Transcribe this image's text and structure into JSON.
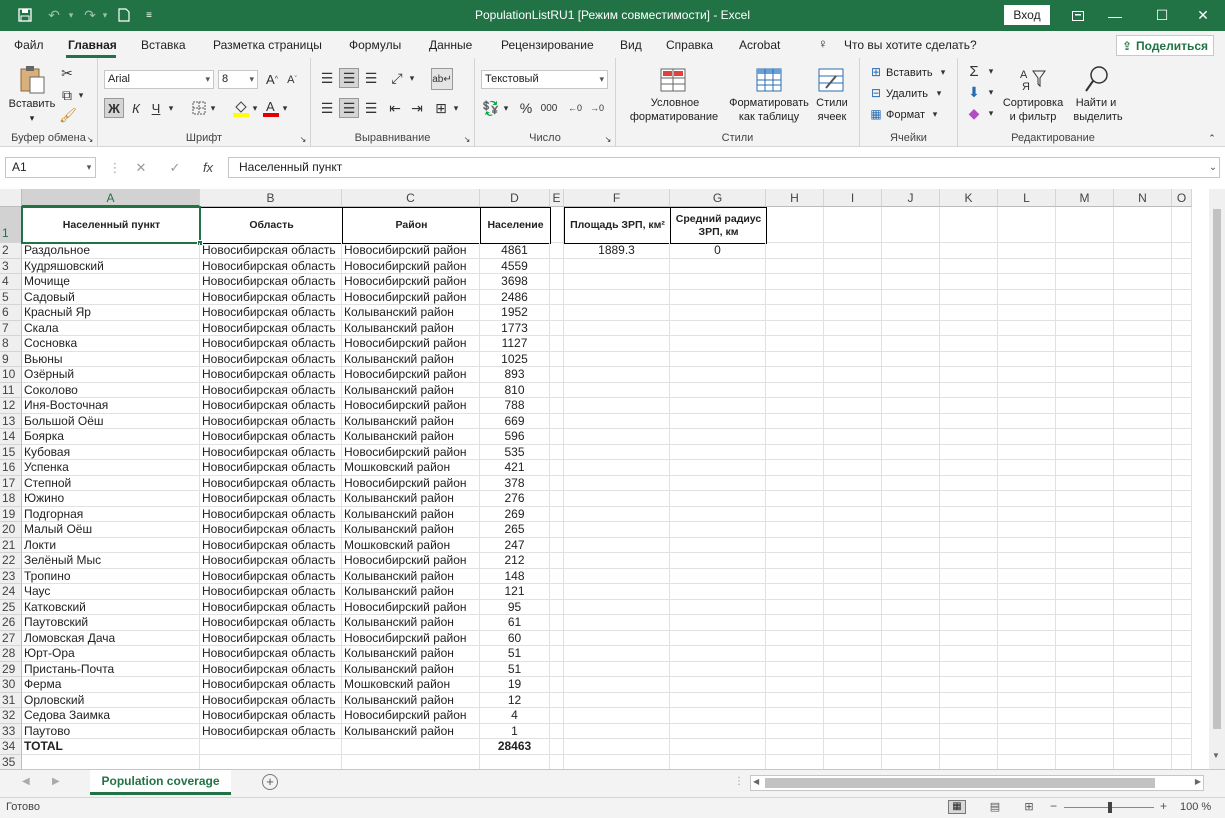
{
  "title": "PopulationListRU1  [Режим совместимости]  -  Excel",
  "login_label": "Вход",
  "menu": [
    "Файл",
    "Главная",
    "Вставка",
    "Разметка страницы",
    "Формулы",
    "Данные",
    "Рецензирование",
    "Вид",
    "Справка",
    "Acrobat"
  ],
  "tell_me": "Что вы хотите сделать?",
  "share_label": "Поделиться",
  "ribbon": {
    "clipboard": {
      "paste": "Вставить",
      "label": "Буфер обмена"
    },
    "font": {
      "name": "Arial",
      "size": "8",
      "bold": "Ж",
      "italic": "К",
      "underline": "Ч",
      "label": "Шрифт"
    },
    "alignment": {
      "label": "Выравнивание"
    },
    "number": {
      "format": "Текстовый",
      "label": "Число"
    },
    "styles": {
      "cond1": "Условное",
      "cond2": "форматирование",
      "table1": "Форматировать",
      "table2": "как таблицу",
      "cell1": "Стили",
      "cell2": "ячеек",
      "label": "Стили"
    },
    "cells": {
      "insert": "Вставить",
      "delete": "Удалить",
      "format": "Формат",
      "label": "Ячейки"
    },
    "editing": {
      "sort1": "Сортировка",
      "sort2": "и фильтр",
      "find1": "Найти и",
      "find2": "выделить",
      "label": "Редактирование"
    }
  },
  "formula": {
    "namebox": "A1",
    "content": "Населенный пункт"
  },
  "columns": [
    "A",
    "B",
    "C",
    "D",
    "E",
    "F",
    "G",
    "H",
    "I",
    "J",
    "K",
    "L",
    "M",
    "N",
    "O"
  ],
  "headers": {
    "a": "Населенный пункт",
    "b": "Область",
    "c": "Район",
    "d": "Население",
    "f": "Площадь ЗРП, км²",
    "g": "Средний радиус ЗРП, км"
  },
  "f2": "1889.3",
  "g2": "0",
  "rows": [
    [
      "Раздольное",
      "Новосибирская область",
      "Новосибирский район",
      "4861"
    ],
    [
      "Кудряшовский",
      "Новосибирская область",
      "Новосибирский район",
      "4559"
    ],
    [
      "Мочище",
      "Новосибирская область",
      "Новосибирский район",
      "3698"
    ],
    [
      "Садовый",
      "Новосибирская область",
      "Новосибирский район",
      "2486"
    ],
    [
      "Красный Яр",
      "Новосибирская область",
      "Колыванский район",
      "1952"
    ],
    [
      "Скала",
      "Новосибирская область",
      "Колыванский район",
      "1773"
    ],
    [
      "Сосновка",
      "Новосибирская область",
      "Новосибирский район",
      "1127"
    ],
    [
      "Вьюны",
      "Новосибирская область",
      "Колыванский район",
      "1025"
    ],
    [
      "Озёрный",
      "Новосибирская область",
      "Новосибирский район",
      "893"
    ],
    [
      "Соколово",
      "Новосибирская область",
      "Колыванский район",
      "810"
    ],
    [
      "Иня-Восточная",
      "Новосибирская область",
      "Новосибирский район",
      "788"
    ],
    [
      "Большой Оёш",
      "Новосибирская область",
      "Колыванский район",
      "669"
    ],
    [
      "Боярка",
      "Новосибирская область",
      "Колыванский район",
      "596"
    ],
    [
      "Кубовая",
      "Новосибирская область",
      "Новосибирский район",
      "535"
    ],
    [
      "Успенка",
      "Новосибирская область",
      "Мошковский район",
      "421"
    ],
    [
      "Степной",
      "Новосибирская область",
      "Новосибирский район",
      "378"
    ],
    [
      "Южино",
      "Новосибирская область",
      "Колыванский район",
      "276"
    ],
    [
      "Подгорная",
      "Новосибирская область",
      "Колыванский район",
      "269"
    ],
    [
      "Малый Оёш",
      "Новосибирская область",
      "Колыванский район",
      "265"
    ],
    [
      "Локти",
      "Новосибирская область",
      "Мошковский район",
      "247"
    ],
    [
      "Зелёный Мыс",
      "Новосибирская область",
      "Новосибирский район",
      "212"
    ],
    [
      "Тропино",
      "Новосибирская область",
      "Колыванский район",
      "148"
    ],
    [
      "Чаус",
      "Новосибирская область",
      "Колыванский район",
      "121"
    ],
    [
      "Катковский",
      "Новосибирская область",
      "Новосибирский район",
      "95"
    ],
    [
      "Паутовский",
      "Новосибирская область",
      "Колыванский район",
      "61"
    ],
    [
      "Ломовская Дача",
      "Новосибирская область",
      "Новосибирский район",
      "60"
    ],
    [
      "Юрт-Ора",
      "Новосибирская область",
      "Колыванский район",
      "51"
    ],
    [
      "Пристань-Почта",
      "Новосибирская область",
      "Колыванский район",
      "51"
    ],
    [
      "Ферма",
      "Новосибирская область",
      "Мошковский район",
      "19"
    ],
    [
      "Орловский",
      "Новосибирская область",
      "Колыванский район",
      "12"
    ],
    [
      "Седова Заимка",
      "Новосибирская область",
      "Новосибирский район",
      "4"
    ],
    [
      "Паутово",
      "Новосибирская область",
      "Колыванский район",
      "1"
    ]
  ],
  "total": {
    "label": "TOTAL",
    "value": "28463"
  },
  "sheet_tab": "Population coverage",
  "status": {
    "ready": "Готово",
    "zoom": "100 %"
  }
}
